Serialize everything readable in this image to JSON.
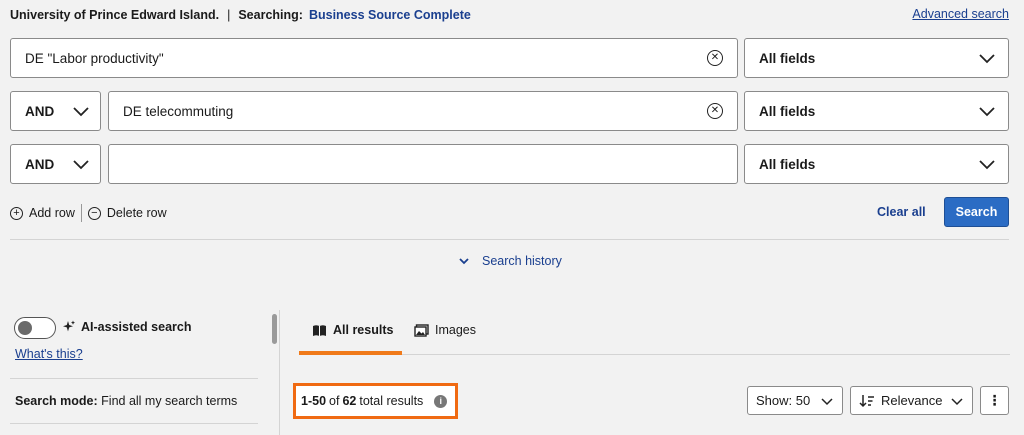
{
  "header": {
    "institution": "University of Prince Edward Island.",
    "separator": "|",
    "searching_label": "Searching:",
    "database": "Business Source Complete",
    "advanced_search": "Advanced search"
  },
  "search_rows": [
    {
      "operator": "",
      "query": "DE \"Labor productivity\"",
      "field": "All fields"
    },
    {
      "operator": "AND",
      "query": "DE telecommuting",
      "field": "All fields"
    },
    {
      "operator": "AND",
      "query": "",
      "field": "All fields"
    }
  ],
  "actions": {
    "add_row": "Add row",
    "delete_row": "Delete row",
    "clear_all": "Clear all",
    "search": "Search",
    "search_history": "Search history"
  },
  "sidebar": {
    "ai_label": "AI-assisted search",
    "ai_enabled": false,
    "whats_this": "What's this?",
    "search_mode_label": "Search mode:",
    "search_mode_value": "Find all my search terms"
  },
  "tabs": [
    {
      "label": "All results",
      "icon": "book-icon",
      "active": true
    },
    {
      "label": "Images",
      "icon": "images-icon",
      "active": false
    }
  ],
  "results": {
    "range": "1-50",
    "of": "of",
    "total": "62",
    "suffix": "total results"
  },
  "controls": {
    "show": "Show: 50",
    "sort": "Relevance",
    "more": "⋮"
  },
  "colors": {
    "link": "#1a3f8f",
    "primary_button": "#2b6cc4",
    "highlight": "#f06a12",
    "tab_underline": "#f07a1a"
  }
}
